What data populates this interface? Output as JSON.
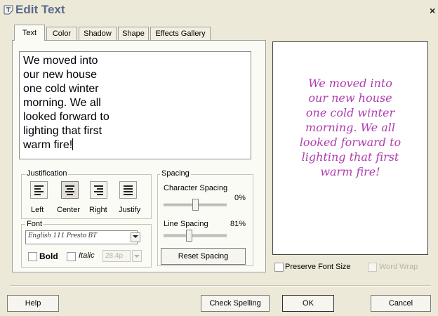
{
  "window": {
    "title": "Edit Text",
    "close_glyph": "×"
  },
  "tabs": [
    "Text",
    "Color",
    "Shadow",
    "Shape",
    "Effects Gallery"
  ],
  "text_editor": {
    "lines": [
      "We moved into",
      "our new house",
      "one cold winter",
      "morning. We all",
      "looked forward to",
      "lighting that first",
      "warm fire!"
    ]
  },
  "justification": {
    "label": "Justification",
    "options": [
      "Left",
      "Center",
      "Right",
      "Justify"
    ],
    "selected": "Center"
  },
  "font": {
    "label": "Font",
    "value": "English 111 Presto BT",
    "bold_label": "Bold",
    "italic_label": "Italic",
    "size_value": "28.4p",
    "bold_checked": false,
    "italic_checked": false
  },
  "spacing": {
    "label": "Spacing",
    "character_label": "Character Spacing",
    "character_value": "0%",
    "character_level": 0.5,
    "line_label": "Line Spacing",
    "line_value": "81%",
    "line_level": 0.4,
    "reset_label": "Reset Spacing"
  },
  "preview": {
    "text": "We moved into\nour new house\none cold winter\nmorning. We all\nlooked forward to\nlighting that first\nwarm fire!",
    "color": "#b03cb0"
  },
  "options": {
    "preserve_font_size": "Preserve Font Size",
    "word_wrap": "Word Wrap"
  },
  "footer": {
    "help": "Help",
    "check_spelling": "Check Spelling",
    "ok": "OK",
    "cancel": "Cancel"
  },
  "colors": {
    "dialog_bg": "#ece9d8",
    "title_text": "#5a6a8c"
  }
}
